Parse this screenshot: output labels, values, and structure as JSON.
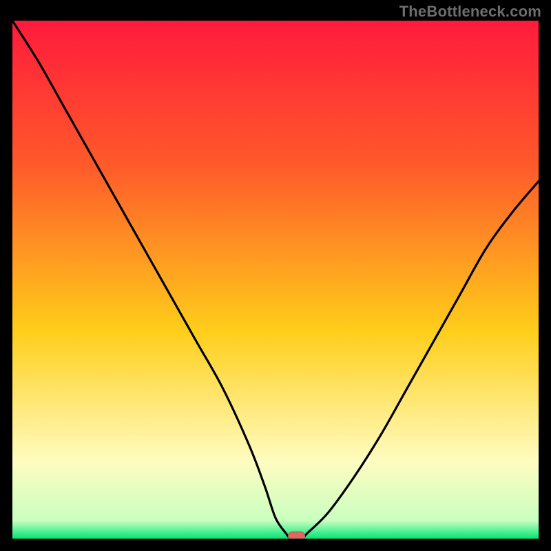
{
  "watermark": "TheBottleneck.com",
  "colors": {
    "frame": "#000000",
    "gradient_top": "#ff1a3c",
    "gradient_upper": "#ff5a2a",
    "gradient_mid": "#ffce1a",
    "gradient_lower": "#fffcc0",
    "gradient_bottom": "#00e874",
    "curve": "#000000",
    "marker_fill": "#d86a62",
    "marker_stroke": "#c15a52"
  },
  "chart_data": {
    "type": "line",
    "title": "",
    "xlabel": "",
    "ylabel": "",
    "xlim": [
      0,
      100
    ],
    "ylim": [
      0,
      100
    ],
    "note": "Values are estimated from pixel positions; the figure has no numeric axes.",
    "series": [
      {
        "name": "bottleneck-curve",
        "x": [
          0,
          5,
          10,
          15,
          20,
          25,
          30,
          35,
          40,
          45,
          48,
          50,
          52,
          53,
          55,
          56,
          60,
          65,
          70,
          75,
          80,
          85,
          90,
          95,
          100
        ],
        "y": [
          100,
          92,
          83,
          74,
          65,
          56,
          47,
          38,
          29,
          18,
          10,
          4,
          1,
          0,
          0,
          1,
          5,
          12,
          20,
          29,
          38,
          47,
          56,
          63,
          69
        ]
      }
    ],
    "marker": {
      "x": 54,
      "y": 0,
      "shape": "rounded-rect"
    },
    "background_gradient": {
      "direction": "vertical",
      "stops": [
        {
          "pos": 0.0,
          "color": "#ff1a3c"
        },
        {
          "pos": 0.28,
          "color": "#ff5a2a"
        },
        {
          "pos": 0.6,
          "color": "#ffce1a"
        },
        {
          "pos": 0.85,
          "color": "#fffcc0"
        },
        {
          "pos": 0.965,
          "color": "#c9ffc0"
        },
        {
          "pos": 1.0,
          "color": "#00e874"
        }
      ]
    }
  }
}
